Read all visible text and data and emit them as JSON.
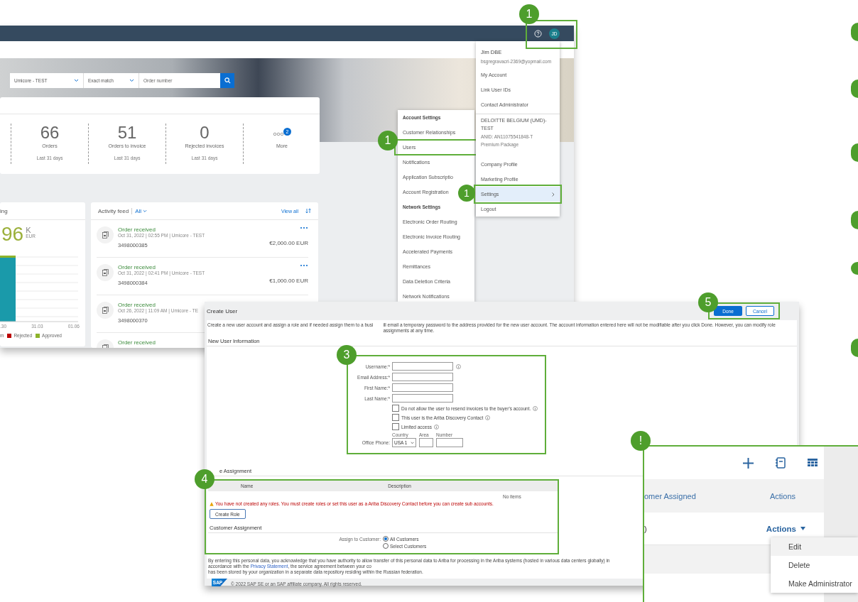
{
  "dashboard": {
    "avatar": "JD",
    "search": {
      "customer": "Umicore - TEST",
      "match": "Exact match",
      "placeholder": "Order number"
    },
    "stats": [
      {
        "value": "66",
        "label": "Orders",
        "period": "Last 31 days"
      },
      {
        "value": "51",
        "label": "Orders to invoice",
        "period": "Last 31 days"
      },
      {
        "value": "0",
        "label": "Rejected invoices",
        "period": "Last 31 days"
      }
    ],
    "more": {
      "label": "More",
      "badge": "2"
    },
    "chart_card": {
      "title": "ing",
      "amount": "96",
      "unit": "K",
      "currency": "EUR",
      "axis_labels": [
        ".30",
        "31.03",
        "01.06"
      ],
      "legend": [
        {
          "label": "m"
        },
        {
          "label": "Rejected",
          "color": "#bb0000"
        },
        {
          "label": "Approved",
          "color": "#8db32a"
        }
      ]
    },
    "feed": {
      "title": "Activity feed",
      "filter": "All",
      "view_all": "View all",
      "items": [
        {
          "status": "Order received",
          "meta": "Oct 31, 2022 | 02:55 PM | Umicore - TEST",
          "number": "3498000385",
          "amount": "€2,000.00 EUR"
        },
        {
          "status": "Order received",
          "meta": "Oct 31, 2022 | 02:41 PM | Umicore - TEST",
          "number": "3498000384",
          "amount": "€1,000.00 EUR"
        },
        {
          "status": "Order received",
          "meta": "Oct 26, 2022 | 11:09 AM | Umicore - TE",
          "number": "3498000370"
        },
        {
          "status": "Order received"
        }
      ]
    }
  },
  "settings_menu": {
    "items": [
      {
        "kind": "header",
        "label": "Account Settings"
      },
      {
        "kind": "item",
        "label": "Customer Relationships",
        "highlighted": false
      },
      {
        "kind": "item",
        "label": "Users",
        "highlighted": true
      },
      {
        "kind": "item",
        "label": "Notifications",
        "highlighted": false
      },
      {
        "kind": "item",
        "label": "Application Subscriptio",
        "highlighted": false
      },
      {
        "kind": "item",
        "label": "Account Registration",
        "highlighted": false
      },
      {
        "kind": "header",
        "label": "Network Settings"
      },
      {
        "kind": "item",
        "label": "Electronic Order Routing",
        "highlighted": false
      },
      {
        "kind": "item",
        "label": "Electronic Invoice Routing",
        "highlighted": false
      },
      {
        "kind": "item",
        "label": "Accelerated Payments",
        "highlighted": false
      },
      {
        "kind": "item",
        "label": "Remittances",
        "highlighted": false
      },
      {
        "kind": "item",
        "label": "Data Deletion Criteria",
        "highlighted": false
      },
      {
        "kind": "item",
        "label": "Network Notifications",
        "highlighted": false
      }
    ]
  },
  "account_menu": {
    "user": "Jim DBE",
    "email": "bsgregravacri-2369@yopmail.com",
    "links": [
      {
        "label": "My Account"
      },
      {
        "label": "Link User IDs"
      },
      {
        "label": "Contact Administrator"
      }
    ],
    "company": {
      "name": "DELOITTE BELGIUM (UMD)-TEST",
      "anid": "ANID: AN11075541848-T",
      "package": "Premium Package"
    },
    "bottom_links": [
      {
        "label": "Company Profile",
        "selected": false,
        "highlighted": false,
        "submenu": false
      },
      {
        "label": "Marketing Profile",
        "selected": false,
        "highlighted": false,
        "submenu": false
      },
      {
        "label": "Settings",
        "selected": true,
        "highlighted": true,
        "submenu": true
      },
      {
        "label": "Logout",
        "selected": false,
        "highlighted": false,
        "submenu": false
      }
    ]
  },
  "create_user": {
    "title": "Create User",
    "done": "Done",
    "cancel": "Cancel",
    "description_parts": [
      "Create a new user account and assign a role and if needed assign them to a busi",
      "ill email a temporary password to the address provided for the new user account. The account information entered here will not be modifiable after you click Done. However, you can modify role assignments at any time."
    ],
    "section_user": "New User Information",
    "fields": [
      {
        "label": "Username:*",
        "info": true
      },
      {
        "label": "Email Address:*",
        "info": false
      },
      {
        "label": "First Name:*",
        "info": false
      },
      {
        "label": "Last Name:*",
        "info": false
      }
    ],
    "checkboxes": [
      {
        "label": "Do not allow the user to resend invoices to the buyer's account.",
        "checked": false,
        "info": true
      },
      {
        "label": "This user is the Ariba Discovery Contact",
        "checked": false,
        "info": true
      },
      {
        "label": "Limited access",
        "checked": false,
        "info": true
      }
    ],
    "phone": {
      "label": "Office Phone:",
      "country_label": "Country",
      "area_label": "Area",
      "number_label": "Number",
      "country": "USA 1"
    },
    "section_role": "e Assignment",
    "role_columns": [
      "Name",
      "Description"
    ],
    "no_items": "No items",
    "warning": "You have not created any roles. You must create roles or set this user as a Ariba Discovery Contact before you can create sub accounts.",
    "create_role": "Create Role",
    "section_customer": "Customer Assignment",
    "assign_label": "Assign to Customer:",
    "assign_options": [
      {
        "label": "All Customers",
        "selected": true
      },
      {
        "label": "Select Customers",
        "selected": false
      }
    ],
    "privacy": {
      "before": "By entering this personal data, you acknowledge that you have authority to allow transfer of this personal data to Ariba for processing in the Ariba systems (hosted in various data centers globally) in accordance with the ",
      "link": "Privacy Statement",
      "after": ", the service agreement between your co",
      "line2": "has been stored by your organization in a separate data repository residing within the Russian federation."
    },
    "footer": {
      "logo": "SAP",
      "copyright": "© 2022 SAP SE or an SAP affiliate company. All rights reserved."
    }
  },
  "users_panel": {
    "column_partial": "omer Assigned",
    "actions_header": "Actions",
    "row_partial": ")",
    "row_actions": "Actions",
    "menu": [
      {
        "label": "Edit",
        "selected": true
      },
      {
        "label": "Delete",
        "selected": false
      },
      {
        "label": "Make Administrator",
        "selected": false
      }
    ]
  },
  "callouts": [
    {
      "label": "1"
    },
    {
      "label": "1"
    },
    {
      "label": "1"
    },
    {
      "label": "3"
    },
    {
      "label": "4"
    },
    {
      "label": "5"
    },
    {
      "label": "!"
    }
  ]
}
